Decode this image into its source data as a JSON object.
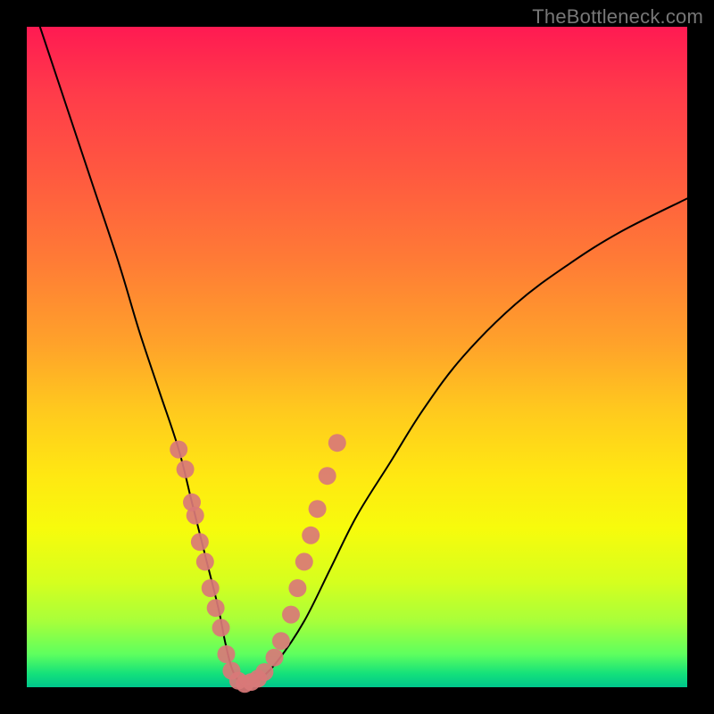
{
  "watermark": "TheBottleneck.com",
  "chart_data": {
    "type": "line",
    "title": "",
    "xlabel": "",
    "ylabel": "",
    "xlim": [
      0,
      100
    ],
    "ylim": [
      0,
      100
    ],
    "grid": false,
    "legend": false,
    "series": [
      {
        "name": "bottleneck-curve",
        "x": [
          2,
          6,
          10,
          14,
          17,
          20,
          23,
          25,
          27,
          29,
          30,
          31,
          32,
          33,
          35,
          38,
          42,
          46,
          50,
          55,
          60,
          66,
          74,
          82,
          90,
          100
        ],
        "y": [
          100,
          88,
          76,
          64,
          54,
          45,
          36,
          28,
          20,
          12,
          7,
          3,
          1,
          0,
          1,
          4,
          10,
          18,
          26,
          34,
          42,
          50,
          58,
          64,
          69,
          74
        ]
      }
    ],
    "markers": [
      {
        "name": "pink-dots",
        "color": "#d97878",
        "points": [
          [
            23,
            36
          ],
          [
            24,
            33
          ],
          [
            25,
            28
          ],
          [
            25.5,
            26
          ],
          [
            26.2,
            22
          ],
          [
            27,
            19
          ],
          [
            27.8,
            15
          ],
          [
            28.6,
            12
          ],
          [
            29.4,
            9
          ],
          [
            30.2,
            5
          ],
          [
            31,
            2.5
          ],
          [
            32,
            1
          ],
          [
            33,
            0.5
          ],
          [
            34,
            0.8
          ],
          [
            35,
            1.3
          ],
          [
            36,
            2.3
          ],
          [
            37.5,
            4.5
          ],
          [
            38.5,
            7
          ],
          [
            40,
            11
          ],
          [
            41,
            15
          ],
          [
            42,
            19
          ],
          [
            43,
            23
          ],
          [
            44,
            27
          ],
          [
            45.5,
            32
          ],
          [
            47,
            37
          ]
        ]
      }
    ]
  }
}
